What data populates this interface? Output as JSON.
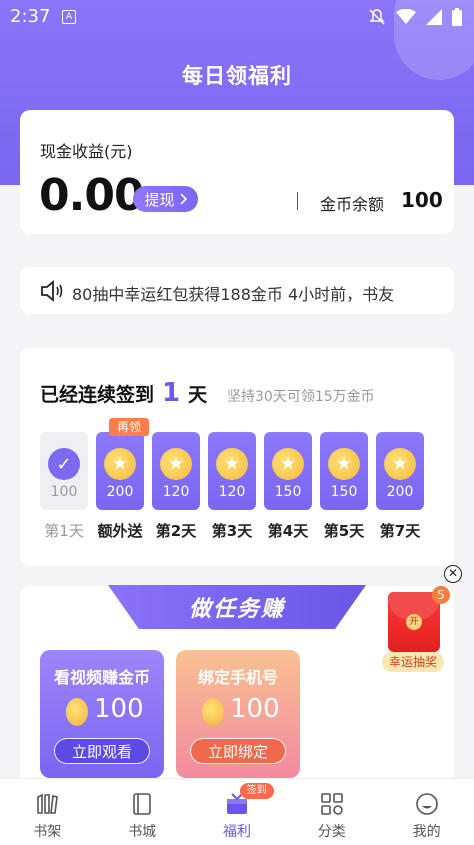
{
  "status_bar": {
    "time": "2:37",
    "a_icon": "A"
  },
  "header": {
    "title": "每日领福利"
  },
  "cash": {
    "label": "现金收益(元)",
    "amount": "0.00",
    "withdraw_label": "提现",
    "coin_label": "金币余额",
    "coin_amount": "100"
  },
  "marquee": {
    "text": "80抽中幸运红包获得188金币  4小时前，书友"
  },
  "checkin": {
    "prefix": "已经连续签到",
    "days": "1",
    "suffix": "天",
    "hint": "坚持30天可领15万金币",
    "again_badge": "再领",
    "items": [
      {
        "label": "第1天",
        "amount": "100",
        "done": true
      },
      {
        "label": "额外送",
        "amount": "200",
        "done": false
      },
      {
        "label": "第2天",
        "amount": "120",
        "done": false
      },
      {
        "label": "第3天",
        "amount": "120",
        "done": false
      },
      {
        "label": "第4天",
        "amount": "150",
        "done": false
      },
      {
        "label": "第5天",
        "amount": "150",
        "done": false
      },
      {
        "label": "第7天",
        "amount": "200",
        "done": false
      }
    ]
  },
  "tasks": {
    "banner": "做任务赚",
    "items": [
      {
        "title": "看视频赚金币",
        "amount": "100",
        "button": "立即观看"
      },
      {
        "title": "绑定手机号",
        "amount": "100",
        "button": "立即绑定"
      }
    ]
  },
  "lucky": {
    "count": "5",
    "label": "幸运抽奖",
    "seal": "开"
  },
  "tabbar": {
    "items": [
      {
        "label": "书架",
        "icon": "bookshelf-icon"
      },
      {
        "label": "书城",
        "icon": "book-icon"
      },
      {
        "label": "福利",
        "icon": "gift-icon",
        "badge": "签到",
        "active": true
      },
      {
        "label": "分类",
        "icon": "category-icon"
      },
      {
        "label": "我的",
        "icon": "profile-icon"
      }
    ]
  },
  "colors": {
    "accent": "#7a66f0",
    "orange": "#ff7d4a"
  }
}
